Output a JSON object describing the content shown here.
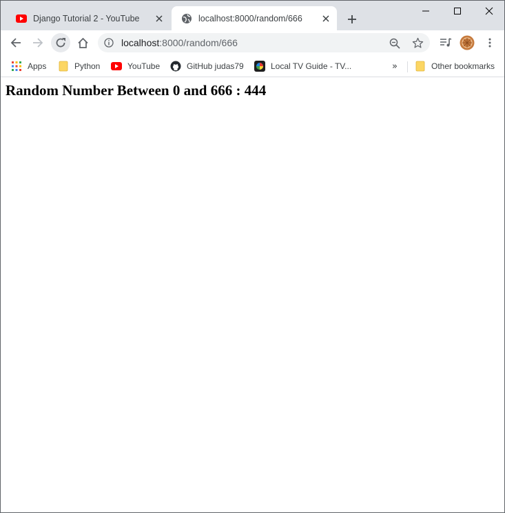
{
  "tabs": [
    {
      "title": "Django Tutorial 2 - YouTube",
      "favicon": "youtube-icon",
      "active": false
    },
    {
      "title": "localhost:8000/random/666",
      "favicon": "globe-icon",
      "active": true
    }
  ],
  "omnibox": {
    "host": "localhost",
    "path": ":8000/random/666"
  },
  "bookmarks": [
    {
      "label": "Apps",
      "icon": "apps-grid-icon"
    },
    {
      "label": "Python",
      "icon": "folder-icon"
    },
    {
      "label": "YouTube",
      "icon": "youtube-icon"
    },
    {
      "label": "GitHub judas79",
      "icon": "github-icon"
    },
    {
      "label": "Local TV Guide - TV...",
      "icon": "tv-guide-icon"
    }
  ],
  "bookmarks_overflow": "»",
  "other_bookmarks": {
    "label": "Other bookmarks",
    "icon": "folder-icon"
  },
  "page": {
    "heading": "Random Number Between 0 and 666 : 444"
  },
  "colors": {
    "tabstrip": "#dee1e6",
    "youtube_red": "#ff0000",
    "folder_yellow": "#fcd663"
  }
}
